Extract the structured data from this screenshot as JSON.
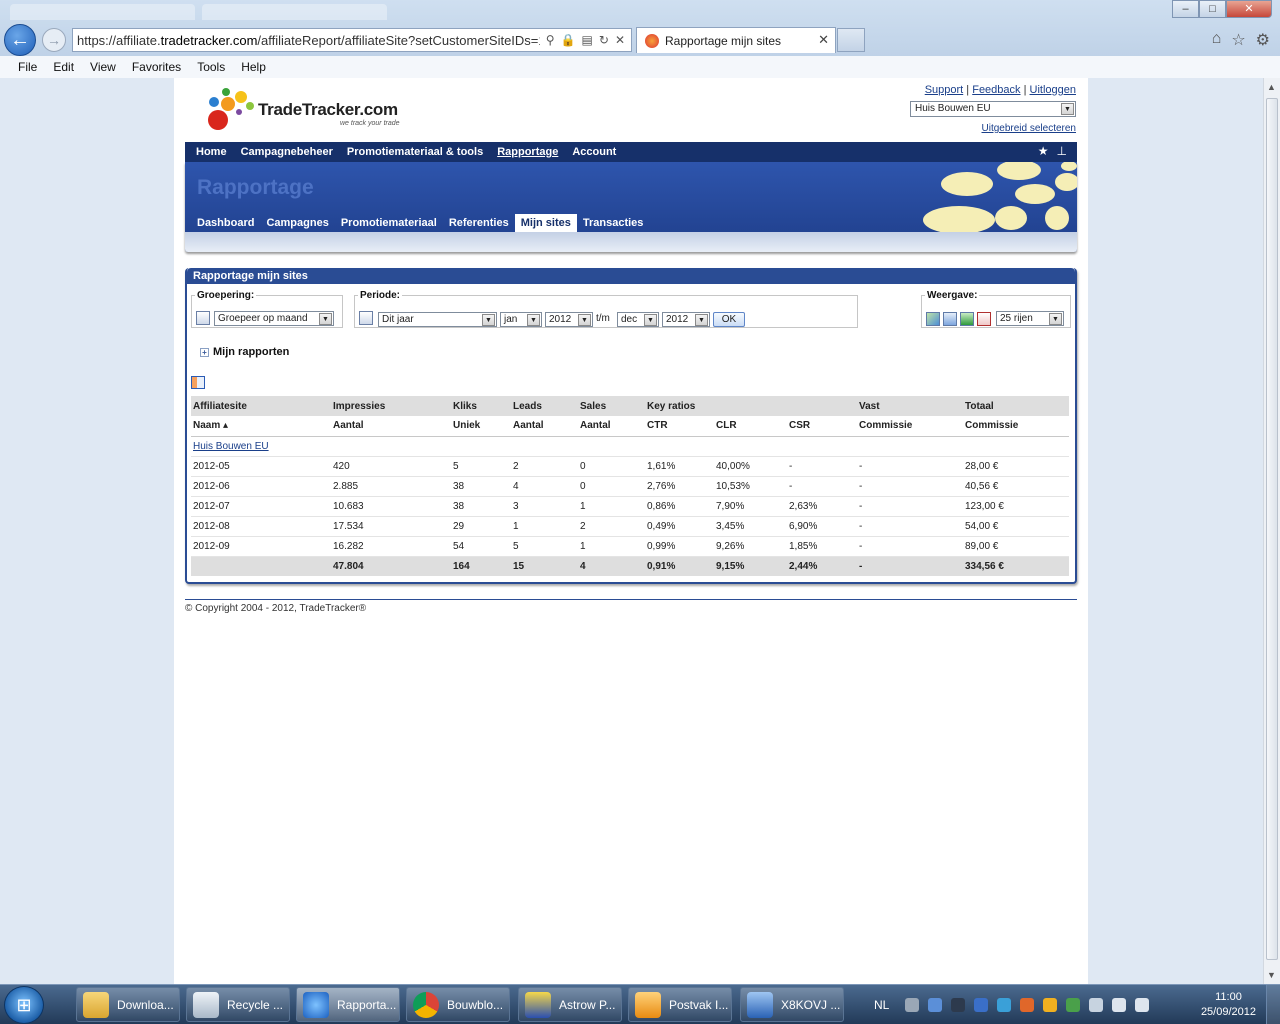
{
  "browser": {
    "url_prefix": "https://affiliate.",
    "url_domain": "tradetracker.com",
    "url_rest": "/affiliateReport/affiliateSite?setCustomerSiteIDs=1",
    "tab_title": "Rapportage mijn sites",
    "menu": [
      "File",
      "Edit",
      "View",
      "Favorites",
      "Tools",
      "Help"
    ]
  },
  "header": {
    "brand": "TradeTracker.com",
    "tagline": "we track your trade",
    "links": {
      "support": "Support",
      "feedback": "Feedback",
      "logout": "Uitloggen"
    },
    "site_selected": "Huis Bouwen EU",
    "advanced_select": "Uitgebreid selecteren"
  },
  "mainnav": [
    "Home",
    "Campagnebeheer",
    "Promotiemateriaal & tools",
    "Rapportage",
    "Account"
  ],
  "banner": {
    "title": "Rapportage",
    "subnav": [
      "Dashboard",
      "Campagnes",
      "Promotiemateriaal",
      "Referenties",
      "Mijn sites",
      "Transacties"
    ]
  },
  "report": {
    "title": "Rapportage mijn sites",
    "groepering": {
      "legend": "Groepering:",
      "value": "Groepeer op maand"
    },
    "periode": {
      "legend": "Periode:",
      "range": "Dit jaar",
      "from_month": "jan",
      "from_year": "2012",
      "to_label": "t/m",
      "to_month": "dec",
      "to_year": "2012",
      "ok": "OK"
    },
    "weergave": {
      "legend": "Weergave:",
      "rows": "25 rijen"
    },
    "my_reports": "Mijn rapporten",
    "table": {
      "header1": [
        "Affiliatesite",
        "Impressies",
        "Kliks",
        "Leads",
        "Sales",
        "Key ratios",
        "",
        "",
        "Vast",
        "Totaal"
      ],
      "header2": [
        "Naam ▴",
        "Aantal",
        "Uniek",
        "Aantal",
        "Aantal",
        "CTR",
        "CLR",
        "CSR",
        "Commissie",
        "Commissie"
      ],
      "group": "Huis Bouwen EU",
      "rows": [
        [
          "2012-05",
          "420",
          "5",
          "2",
          "0",
          "1,61%",
          "40,00%",
          "-",
          "-",
          "28,00 €"
        ],
        [
          "2012-06",
          "2.885",
          "38",
          "4",
          "0",
          "2,76%",
          "10,53%",
          "-",
          "-",
          "40,56 €"
        ],
        [
          "2012-07",
          "10.683",
          "38",
          "3",
          "1",
          "0,86%",
          "7,90%",
          "2,63%",
          "-",
          "123,00 €"
        ],
        [
          "2012-08",
          "17.534",
          "29",
          "1",
          "2",
          "0,49%",
          "3,45%",
          "6,90%",
          "-",
          "54,00 €"
        ],
        [
          "2012-09",
          "16.282",
          "54",
          "5",
          "1",
          "0,99%",
          "9,26%",
          "1,85%",
          "-",
          "89,00 €"
        ]
      ],
      "total": [
        "",
        "47.804",
        "164",
        "15",
        "4",
        "0,91%",
        "9,15%",
        "2,44%",
        "-",
        "334,56 €"
      ]
    }
  },
  "footer": {
    "copyright": "© Copyright 2004 - 2012, TradeTracker®"
  },
  "taskbar": {
    "tasks": [
      "Downloa...",
      "Recycle ...",
      "Rapporta...",
      "Bouwblo...",
      "Astrow P...",
      "Postvak I...",
      "X8KOVJ ..."
    ],
    "lang": "NL",
    "time": "11:00",
    "date": "25/09/2012"
  }
}
